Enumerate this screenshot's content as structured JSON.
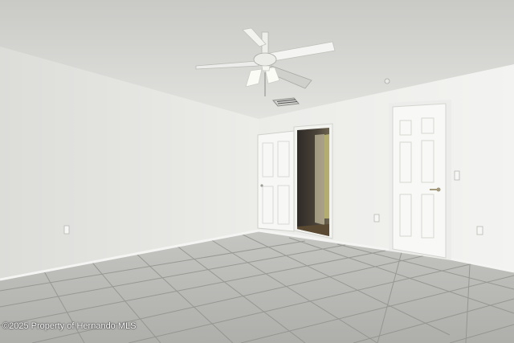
{
  "watermark": {
    "text": "©2025 Property of Hernando MLS"
  }
}
